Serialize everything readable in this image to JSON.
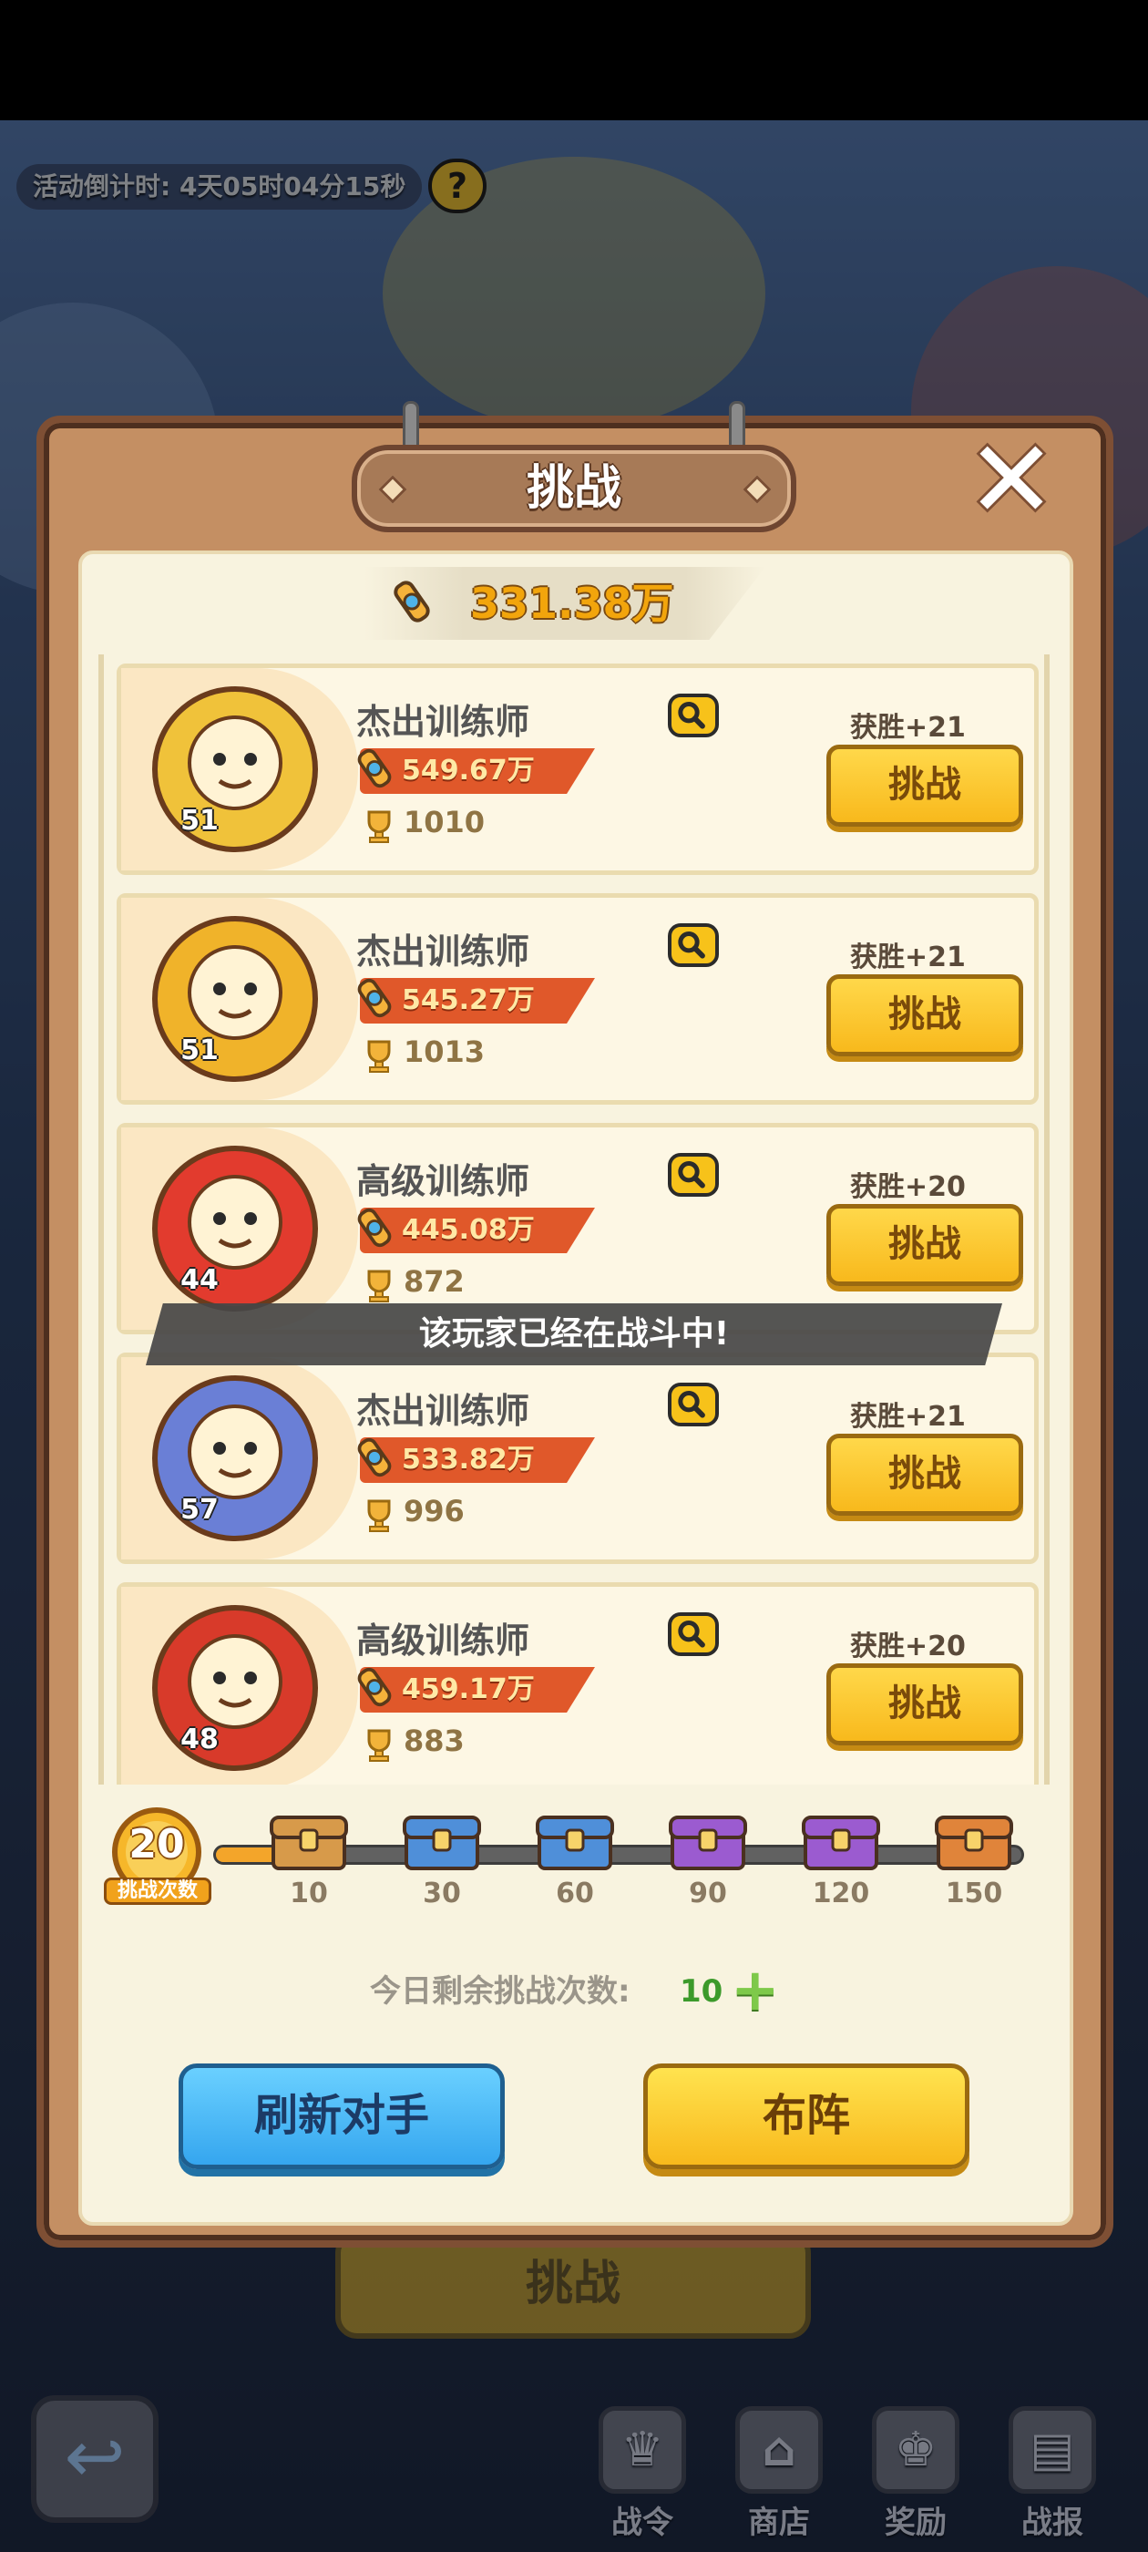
{
  "hud": {
    "countdown": "活动倒计时: 4天05时04分15秒",
    "help": "?"
  },
  "modal": {
    "title": "挑战",
    "close": "✕",
    "my_power": "331.38万"
  },
  "opponents": [
    {
      "rank": "杰出训练师",
      "power": "549.67万",
      "trophies": "1010",
      "level": "51",
      "reward": "获胜+21",
      "button": "挑战",
      "accent": "#f0c23a"
    },
    {
      "rank": "杰出训练师",
      "power": "545.27万",
      "trophies": "1013",
      "level": "51",
      "reward": "获胜+21",
      "button": "挑战",
      "accent": "#f0b32a"
    },
    {
      "rank": "高级训练师",
      "power": "445.08万",
      "trophies": "872",
      "level": "44",
      "reward": "获胜+20",
      "button": "挑战",
      "accent": "#e23b2e"
    },
    {
      "rank": "杰出训练师",
      "power": "533.82万",
      "trophies": "996",
      "level": "57",
      "reward": "获胜+21",
      "button": "挑战",
      "accent": "#6a7fd6"
    },
    {
      "rank": "高级训练师",
      "power": "459.17万",
      "trophies": "883",
      "level": "48",
      "reward": "获胜+20",
      "button": "挑战",
      "accent": "#d83a2a"
    }
  ],
  "toast": "该玩家已经在战斗中!",
  "progress": {
    "count": "20",
    "count_label": "挑战次数",
    "fill_fraction": 0.13,
    "milestones": [
      {
        "label": "10",
        "chest": "wood-chest-icon",
        "color": "#d79a4a"
      },
      {
        "label": "30",
        "chest": "blue-chest-icon",
        "color": "#4f8fd9"
      },
      {
        "label": "60",
        "chest": "blue-chest-icon",
        "color": "#4f8fd9"
      },
      {
        "label": "90",
        "chest": "purple-chest-icon",
        "color": "#9b5bd0"
      },
      {
        "label": "120",
        "chest": "purple-chest-icon",
        "color": "#9b5bd0"
      },
      {
        "label": "150",
        "chest": "orange-chest-icon",
        "color": "#e0843a"
      }
    ]
  },
  "remaining": {
    "label": "今日剩余挑战次数:",
    "count": "10",
    "add": "+"
  },
  "buttons": {
    "refresh": "刷新对手",
    "formation": "布阵"
  },
  "background": {
    "under_button": "挑战",
    "nav": [
      "战令",
      "商店",
      "奖励",
      "战报"
    ]
  }
}
